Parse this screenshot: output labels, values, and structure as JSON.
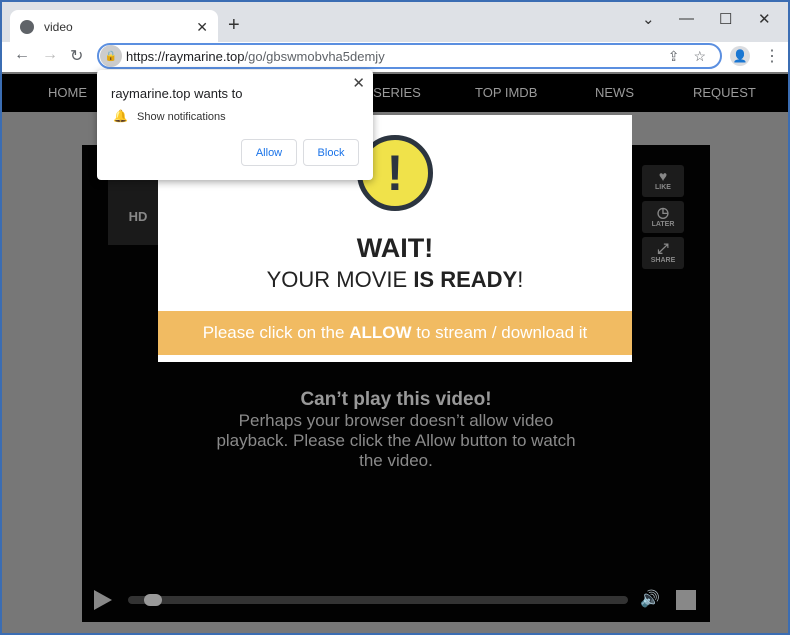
{
  "browser": {
    "tab_title": "video",
    "url_domain": "https://raymarine.top",
    "url_path": "/go/gbswmobvha5demjy"
  },
  "nav": {
    "items": [
      "HOME",
      "TV - SERIES",
      "TOP IMDB",
      "NEWS",
      "REQUEST"
    ]
  },
  "player": {
    "hd_label": "HD",
    "like": "LIKE",
    "later": "LATER",
    "share": "SHARE",
    "error_title": "Can’t play this video!",
    "error_lines": [
      "Perhaps your browser doesn’t allow video",
      "playback. Please click the Allow button to watch",
      "the video."
    ],
    "progress_percent": 3
  },
  "modal": {
    "title": "WAIT!",
    "subtitle_plain": "YOUR MOVIE ",
    "subtitle_bold": "IS READY",
    "subtitle_end": "!",
    "bar_pre": "Please click on the ",
    "bar_bold": "ALLOW",
    "bar_post": " to stream / download it",
    "accent": "#f1bb62"
  },
  "popup": {
    "title": "raymarine.top wants to",
    "permission": "Show notifications",
    "allow": "Allow",
    "block": "Block"
  }
}
